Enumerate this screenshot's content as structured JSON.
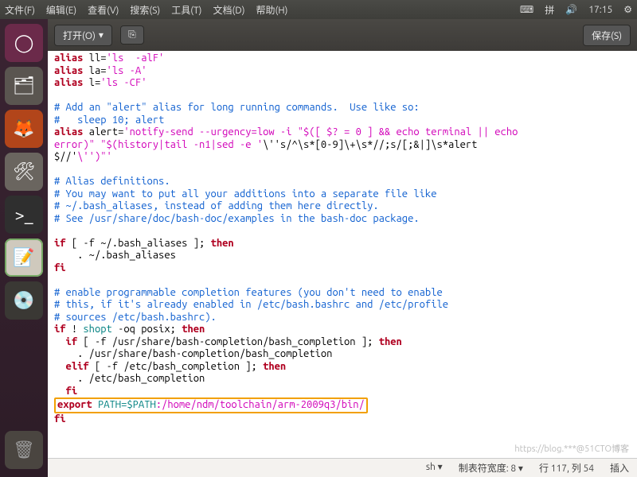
{
  "topbar": {
    "menus": [
      "文件(F)",
      "编辑(E)",
      "查看(V)",
      "搜索(S)",
      "工具(T)",
      "文档(D)",
      "帮助(H)"
    ],
    "time": "17:15"
  },
  "toolbar": {
    "open_label": "打开(O)",
    "save_label": "保存(S)"
  },
  "code": {
    "l1a": "alias",
    "l1b": " ll=",
    "l1c": "'ls  -alF'",
    "l2a": "alias",
    "l2b": " la=",
    "l2c": "'ls -A'",
    "l3a": "alias",
    "l3b": " l=",
    "l3c": "'ls -CF'",
    "c1": "# Add an \"alert\" alias for long running commands.  Use like so:",
    "c2": "#   sleep 10; alert",
    "l4a": "alias",
    "l4b": " alert=",
    "l4c": "'notify-send --urgency=low -i \"$([ $? = 0 ] && echo terminal || echo ",
    "l4d": "error)\" \"$(history|tail -n1|sed -e '",
    "l4e": "\\''s/^\\s*[0-9]\\+\\s*//;s/[;&|]\\s*alert",
    "l4f": "$//'",
    "l4g": "\\'')\"'",
    "c3": "# Alias definitions.",
    "c4": "# You may want to put all your additions into a separate file like",
    "c5": "# ~/.bash_aliases, instead of adding them here directly.",
    "c6": "# See /usr/share/doc/bash-doc/examples in the bash-doc package.",
    "l5a": "if",
    "l5b": " [ -f ~/.bash_aliases ]; ",
    "l5c": "then",
    "l6": "    . ~/.bash_aliases",
    "l7": "fi",
    "c7": "# enable programmable completion features (you don't need to enable",
    "c8": "# this, if it's already enabled in /etc/bash.bashrc and /etc/profile",
    "c9": "# sources /etc/bash.bashrc).",
    "l8a": "if",
    "l8b": " ! ",
    "l8c": "shopt",
    "l8d": " -oq posix; ",
    "l8e": "then",
    "l9a": "  if",
    "l9b": " [ -f /usr/share/bash-completion/bash_completion ]; ",
    "l9c": "then",
    "l10": "    . /usr/share/bash-completion/bash_completion",
    "l11a": "  elif",
    "l11b": " [ -f /etc/bash_completion ]; ",
    "l11c": "then",
    "l12": "    . /etc/bash_completion",
    "l13": "  fi",
    "l14a": "export",
    "l14b": " PATH=$PATH",
    "l14c": ":/home/ndm/toolchain/arm-2009q3/bin/",
    "l15": "fi"
  },
  "status": {
    "lang": "sh ▾",
    "tab": "制表符宽度: 8 ▾",
    "pos": "行 117,  列 54",
    "mode": "插入"
  },
  "watermark": "https://blog.***@51CTO博客"
}
